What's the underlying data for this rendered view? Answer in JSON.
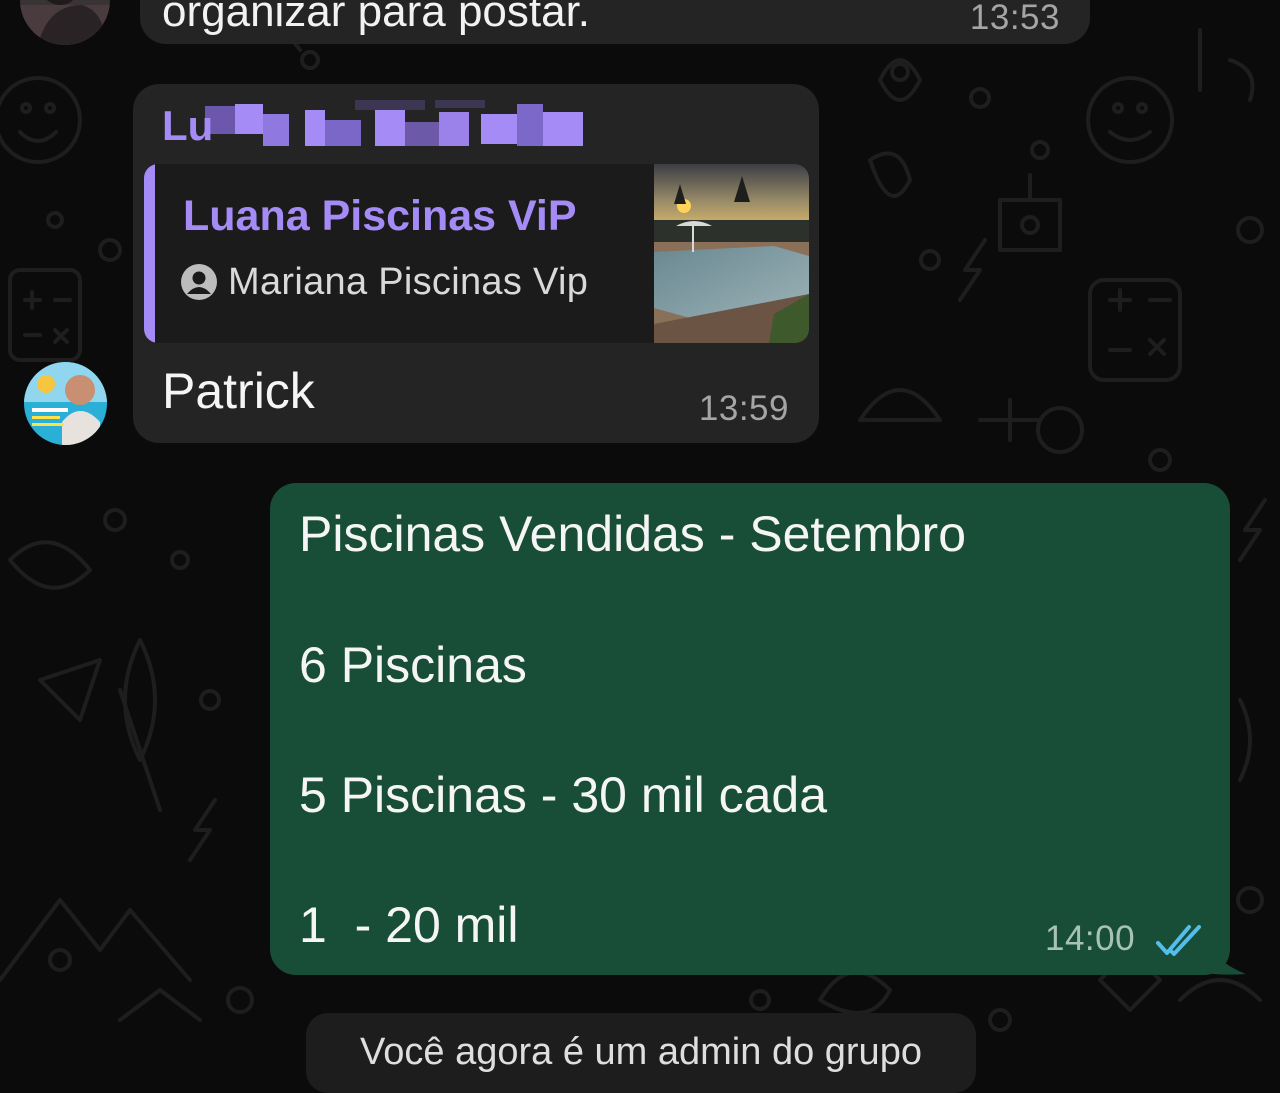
{
  "theme": {
    "chat_background": "#0b0b0b",
    "incoming_bubble": "#242424",
    "outgoing_bubble": "#184d37",
    "accent_name": "#a58bf5",
    "read_ticks": "#53bdeb"
  },
  "messages": [
    {
      "type": "incoming",
      "text": "organizar para postar.",
      "time": "13:53",
      "avatar_icon": "person-photo-avatar"
    },
    {
      "type": "incoming",
      "sender_name": "Lu",
      "quote": {
        "title": "Luana Piscinas ViP",
        "author": "Mariana Piscinas Vip",
        "author_icon": "contact-person-icon",
        "thumbnail": "pool-photo"
      },
      "text": "Patrick",
      "time": "13:59",
      "avatar_icon": "pool-ad-avatar"
    },
    {
      "type": "outgoing",
      "lines": [
        "Piscinas Vendidas - Setembro",
        "6 Piscinas",
        "5 Piscinas - 30 mil cada",
        "1  - 20 mil"
      ],
      "time": "14:00",
      "status_icon": "double-check-read-icon"
    }
  ],
  "system_message": {
    "text": "Você agora é um admin do grupo"
  }
}
